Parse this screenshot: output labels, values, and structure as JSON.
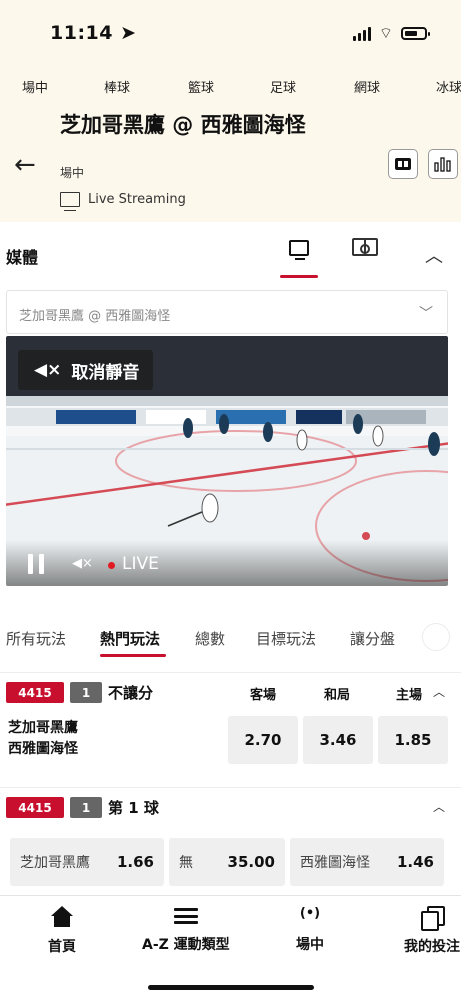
{
  "status_bar": {
    "time": "11:14"
  },
  "sports_nav": {
    "items": [
      "場中",
      "棒球",
      "籃球",
      "足球",
      "網球",
      "冰球"
    ]
  },
  "match": {
    "title": "芝加哥黑鷹 @ 西雅圖海怪",
    "status": "場中",
    "streaming_label": "Live Streaming"
  },
  "media": {
    "label": "媒體",
    "selector_value": "芝加哥黑鷹 @ 西雅圖海怪",
    "unmute_label": "取消靜音",
    "live_label": "LIVE"
  },
  "bet_tabs": {
    "items": [
      "所有玩法",
      "熱門玩法",
      "總數",
      "目標玩法",
      "讓分盤"
    ],
    "active": "熱門玩法"
  },
  "markets": [
    {
      "id": "4415",
      "period": "1",
      "name": "不讓分",
      "columns": [
        "客場",
        "和局",
        "主場"
      ],
      "teams": [
        "芝加哥黑鷹",
        "西雅圖海怪"
      ],
      "odds": [
        "2.70",
        "3.46",
        "1.85"
      ]
    },
    {
      "id": "4415",
      "period": "1",
      "name": "第 1 球",
      "options": [
        {
          "label": "芝加哥黑鷹",
          "odd": "1.66"
        },
        {
          "label": "無",
          "odd": "35.00"
        },
        {
          "label": "西雅圖海怪",
          "odd": "1.46"
        }
      ]
    }
  ],
  "bottom_nav": {
    "items": [
      {
        "label": "首頁",
        "icon": "home-icon"
      },
      {
        "label": "A-Z 運動類型",
        "icon": "menu-icon"
      },
      {
        "label": "場中",
        "icon": "live-signal-icon"
      },
      {
        "label": "我的投注",
        "icon": "copy-icon"
      }
    ]
  },
  "colors": {
    "accent": "#c8102e",
    "header_bg": "#fdf8ec",
    "odds_bg": "#efefef"
  }
}
